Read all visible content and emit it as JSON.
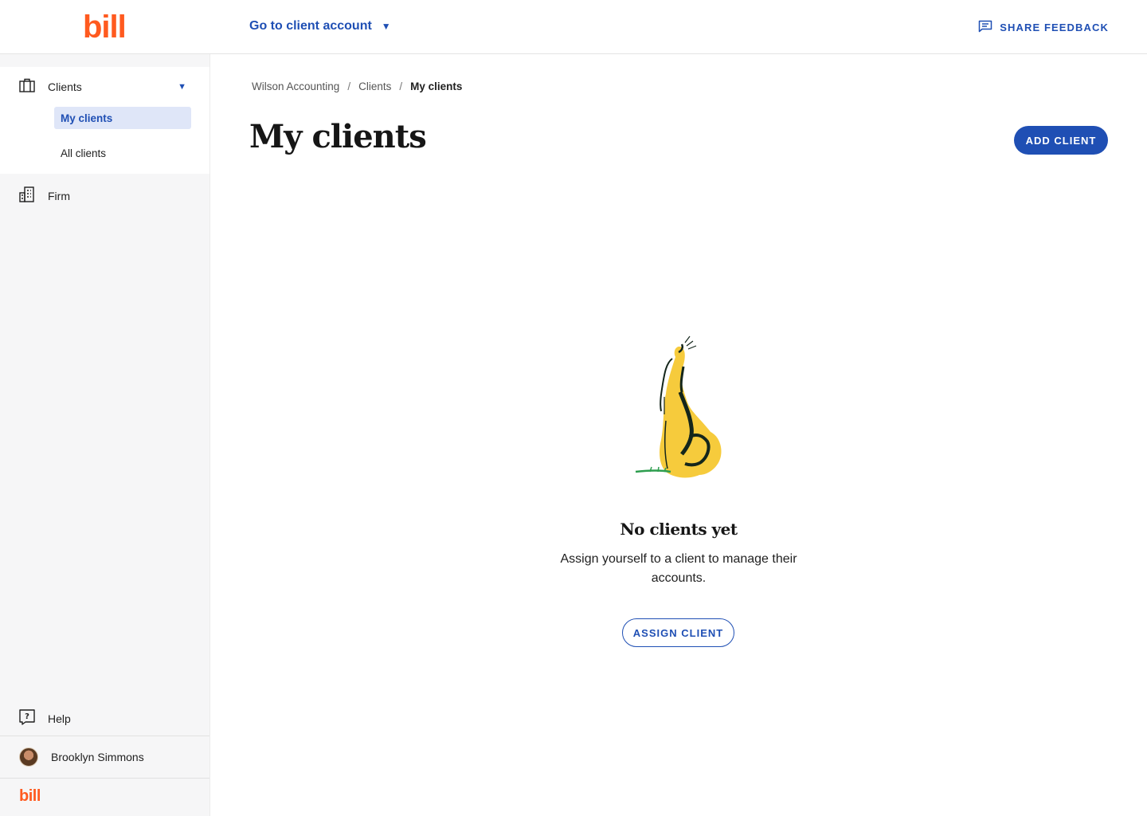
{
  "brand": {
    "logo_text": "bill",
    "accent_color": "#ff5a1f",
    "primary_color": "#1f4fb4"
  },
  "header": {
    "goto_label": "Go to client account",
    "goto_icon": "caret-down-icon",
    "feedback_label": "SHARE FEEDBACK",
    "feedback_icon": "message-icon"
  },
  "sidebar": {
    "clients": {
      "label": "Clients",
      "icon": "briefcase-icon"
    },
    "sub_items": [
      {
        "label": "My clients",
        "active": true
      },
      {
        "label": "All clients",
        "active": false
      }
    ],
    "firm": {
      "label": "Firm",
      "icon": "building-icon"
    },
    "help": {
      "label": "Help",
      "icon": "help-icon"
    },
    "user": {
      "name": "Brooklyn Simmons"
    },
    "footer_logo": "bill"
  },
  "breadcrumb": {
    "items": [
      "Wilson Accounting",
      "Clients",
      "My clients"
    ],
    "separator": "/"
  },
  "page": {
    "title": "My clients",
    "add_button": "ADD CLIENT"
  },
  "empty_state": {
    "title": "No clients yet",
    "text": "Assign yourself to a client to manage their accounts.",
    "button": "ASSIGN CLIENT"
  }
}
